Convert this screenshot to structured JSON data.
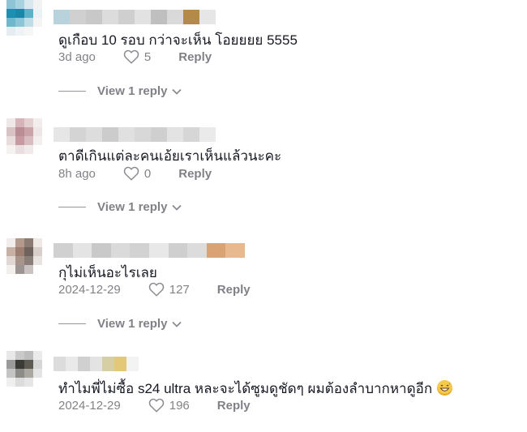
{
  "comments": [
    {
      "text": "ดูเกือบ 10 รอบ กว่าจะเห็น โอยยยย 5555",
      "date": "3d ago",
      "likes": "5",
      "reply_label": "Reply",
      "view_replies": "View 1 reply",
      "avatar_colors": [
        "#8fc3d6",
        "#a9d2e0",
        "#d8e8ee",
        "#f2f2f2",
        "#1d8fb3",
        "#1a86a8",
        "#5fb0c9",
        "#e9f2f5",
        "#6fb7cc",
        "#8cc6d6",
        "#bfdde7",
        "#f4f4f4",
        "#e4eef2",
        "#eef4f6",
        "#f6f6f6",
        "#ffffff"
      ],
      "username_colors": [
        "#b9d3dc",
        "#d0d0d0",
        "#c8c8c8",
        "#dcdcdc",
        "#cfcfcf",
        "#e2e2e2",
        "#bfbfbf",
        "#d9d9d9",
        "#b48a4a",
        "#e6e6e6"
      ]
    },
    {
      "text": "ตาดีเกินแต่ละคนเอ้ยเราเห็นแล้วนะคะ",
      "date": "8h ago",
      "likes": "0",
      "reply_label": "Reply",
      "view_replies": "View 1 reply",
      "avatar_colors": [
        "#efe8e8",
        "#d6b3b8",
        "#e4cfd1",
        "#f3eeee",
        "#d9c2c4",
        "#b98d93",
        "#c9a3a8",
        "#eee6e6",
        "#e9dcdd",
        "#c79aa1",
        "#d8bcc0",
        "#f4efef",
        "#f6f2f2",
        "#eadfe0",
        "#f1eaea",
        "#ffffff"
      ],
      "username_colors": [
        "#e6e6e6",
        "#d4d4d4",
        "#dddddd",
        "#cccccc",
        "#e0e0e0",
        "#d8d8d8",
        "#cfcfcf",
        "#e3e3e3",
        "#d6d6d6",
        "#eaeaea"
      ]
    },
    {
      "text": "กุไม่เห็นอะไรเลย",
      "date": "2024-12-29",
      "likes": "127",
      "reply_label": "Reply",
      "view_replies": "View 1 reply",
      "avatar_colors": [
        "#f2eded",
        "#b49a8c",
        "#8c7b72",
        "#efe9e6",
        "#c7b1a5",
        "#9c7f70",
        "#6f625d",
        "#d9cfca",
        "#e2d8d3",
        "#a8948b",
        "#8a7e79",
        "#e9e4e2",
        "#f3efed",
        "#9d9594",
        "#c9c2c0",
        "#ffffff"
      ],
      "username_colors": [
        "#d0d0d0",
        "#e4e4e4",
        "#c9c9c9",
        "#dadada",
        "#d2d2d2",
        "#e8e8e8",
        "#cfcfcf",
        "#dcdcdc",
        "#d9a374",
        "#e8b88e"
      ]
    },
    {
      "text": "ทำไมพี่ไม่ซื้อ s24 ultra หละจะได้ซูมดูชัดๆ ผมต้องลำบากหาดูอีก",
      "date": "2024-12-29",
      "likes": "196",
      "reply_label": "Reply",
      "view_replies": "",
      "avatar_colors": [
        "#e8e8e8",
        "#c9c9c9",
        "#bdbdbd",
        "#ebebeb",
        "#9a9a9a",
        "#3a3a36",
        "#5d5a52",
        "#d6d6d6",
        "#c4c4c4",
        "#8e8c86",
        "#a9a7a0",
        "#e4e4e4",
        "#efefef",
        "#dcdcdc",
        "#e6e6e6",
        "#ffffff"
      ],
      "username_colors": [
        "#dcdcdc",
        "#e9e9e9",
        "#d0d0d0",
        "#e3e3e3",
        "#d7cfa4",
        "#e3c877",
        "#f3f3f3",
        "#ffffff",
        "#ffffff",
        "#ffffff"
      ]
    }
  ],
  "icons": {
    "like": "heart-outline-icon",
    "expand": "chevron-down-icon",
    "emoji": "grinning-sweat-emoji"
  }
}
